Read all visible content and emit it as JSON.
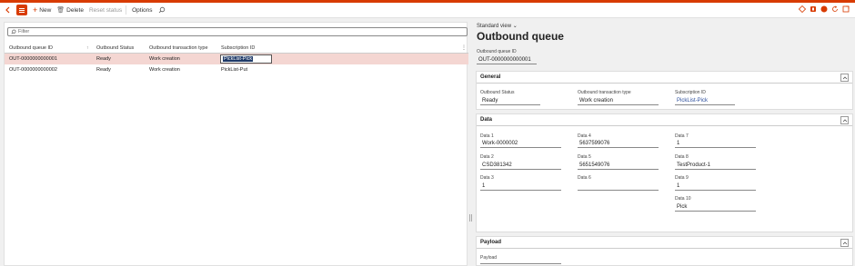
{
  "toolbar": {
    "new_label": "New",
    "delete_label": "Delete",
    "reset_status_label": "Reset status",
    "options_label": "Options",
    "notification_count": "0"
  },
  "grid": {
    "filter_placeholder": "Filter",
    "columns": [
      "Outbound queue ID",
      "Outbound Status",
      "Outbound transaction type",
      "Subscription ID"
    ],
    "rows": [
      {
        "id": "OUT-0000000000001",
        "status": "Ready",
        "type": "Work creation",
        "subscription": "PickList-Pick"
      },
      {
        "id": "OUT-0000000000002",
        "status": "Ready",
        "type": "Work creation",
        "subscription": "PickList-Put"
      }
    ]
  },
  "detail": {
    "view_label": "Standard view",
    "title": "Outbound queue",
    "id_label": "Outbound queue ID",
    "id_value": "OUT-0000000000001",
    "general": {
      "title": "General",
      "status_label": "Outbound Status",
      "status_value": "Ready",
      "type_label": "Outbound transaction type",
      "type_value": "Work creation",
      "sub_label": "Subscription ID",
      "sub_value": "PickList-Pick"
    },
    "data": {
      "title": "Data",
      "d1_label": "Data 1",
      "d1": "Work-0000002",
      "d2_label": "Data 2",
      "d2": "CSD381342",
      "d3_label": "Data 3",
      "d3": "1",
      "d4_label": "Data 4",
      "d4": "5637599076",
      "d5_label": "Data 5",
      "d5": "5651549076",
      "d6_label": "Data 6",
      "d6": "",
      "d7_label": "Data 7",
      "d7": "1",
      "d8_label": "Data 8",
      "d8": "TestProduct-1",
      "d9_label": "Data 9",
      "d9": "1",
      "d10_label": "Data 10",
      "d10": "Pick"
    },
    "payload": {
      "title": "Payload",
      "label": "Payload",
      "value": ""
    }
  }
}
